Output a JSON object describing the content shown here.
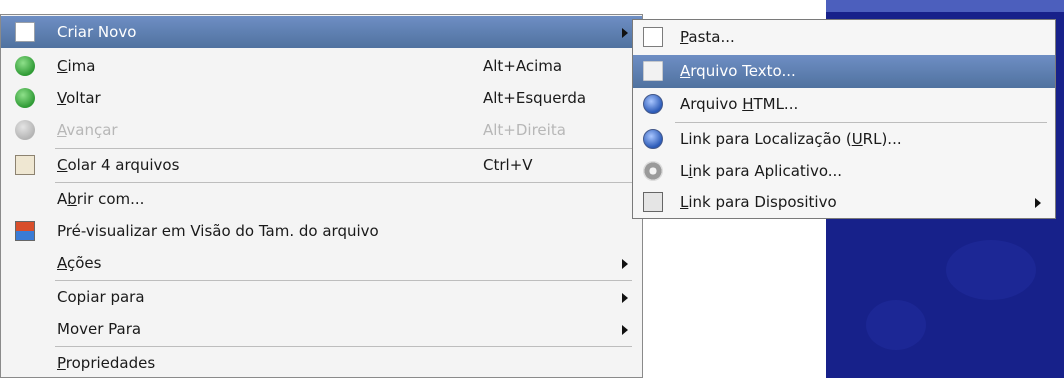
{
  "main_menu": {
    "items": [
      {
        "id": "criar-novo",
        "label": "Criar Novo",
        "shortcut": "",
        "icon": "new-document-icon",
        "submenu": true,
        "state": "highlighted"
      },
      {
        "id": "cima",
        "label": "Cima",
        "shortcut": "Alt+Acima",
        "icon": "up-arrow-icon",
        "submenu": false,
        "state": "normal"
      },
      {
        "id": "voltar",
        "label": "Voltar",
        "shortcut": "Alt+Esquerda",
        "icon": "back-arrow-icon",
        "submenu": false,
        "state": "normal"
      },
      {
        "id": "avancar",
        "label": "Avançar",
        "shortcut": "Alt+Direita",
        "icon": "forward-arrow-icon",
        "submenu": false,
        "state": "disabled"
      },
      {
        "id": "colar",
        "label": "Colar 4 arquivos",
        "shortcut": "Ctrl+V",
        "icon": "paste-icon",
        "submenu": false,
        "state": "normal"
      },
      {
        "id": "abrir-com",
        "label": "Abrir com...",
        "shortcut": "",
        "icon": "",
        "submenu": false,
        "state": "normal"
      },
      {
        "id": "pre-visualizar",
        "label": "Pré-visualizar em Visão do Tam. do arquivo",
        "shortcut": "",
        "icon": "treemap-view-icon",
        "submenu": false,
        "state": "normal"
      },
      {
        "id": "acoes",
        "label": "Ações",
        "shortcut": "",
        "icon": "",
        "submenu": true,
        "state": "normal"
      },
      {
        "id": "copiar-para",
        "label": "Copiar para",
        "shortcut": "",
        "icon": "",
        "submenu": true,
        "state": "normal"
      },
      {
        "id": "mover-para",
        "label": "Mover Para",
        "shortcut": "",
        "icon": "",
        "submenu": true,
        "state": "normal"
      },
      {
        "id": "propriedades",
        "label": "Propriedades",
        "shortcut": "",
        "icon": "",
        "submenu": false,
        "state": "normal"
      }
    ]
  },
  "sub_menu": {
    "items": [
      {
        "id": "pasta",
        "label": "Pasta...",
        "icon": "folder-icon",
        "submenu": false,
        "state": "normal"
      },
      {
        "id": "arquivo-texto",
        "label": "Arquivo Texto...",
        "icon": "text-file-icon",
        "submenu": false,
        "state": "highlighted"
      },
      {
        "id": "arquivo-html",
        "label": "Arquivo HTML...",
        "icon": "html-file-icon",
        "submenu": false,
        "state": "normal"
      },
      {
        "id": "link-url",
        "label": "Link para Localização (URL)...",
        "icon": "url-link-icon",
        "submenu": false,
        "state": "normal"
      },
      {
        "id": "link-aplicativo",
        "label": "Link para Aplicativo...",
        "icon": "application-link-icon",
        "submenu": false,
        "state": "normal"
      },
      {
        "id": "link-dispositivo",
        "label": "Link para Dispositivo",
        "icon": "device-link-icon",
        "submenu": true,
        "state": "normal"
      }
    ]
  },
  "colors": {
    "highlight": "#5f80b5",
    "desktop_background": "#17218a",
    "menu_background": "#f4f4f4",
    "disabled_text": "#b7b7b7"
  }
}
